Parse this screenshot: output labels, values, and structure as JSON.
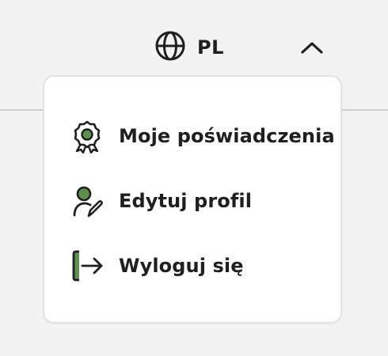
{
  "header": {
    "language": {
      "icon": "globe-icon",
      "label": "PL"
    },
    "toggle_icon": "chevron-up-icon"
  },
  "menu": {
    "items": [
      {
        "icon": "award-badge-icon",
        "label": "Moje poświadczenia"
      },
      {
        "icon": "user-edit-icon",
        "label": "Edytuj profil"
      },
      {
        "icon": "logout-icon",
        "label": "Wyloguj się"
      }
    ]
  },
  "colors": {
    "accent": "#5f8f4f",
    "text": "#1f1f1f",
    "menu_border": "#e2e2e2",
    "background": "#f3f3f3"
  }
}
